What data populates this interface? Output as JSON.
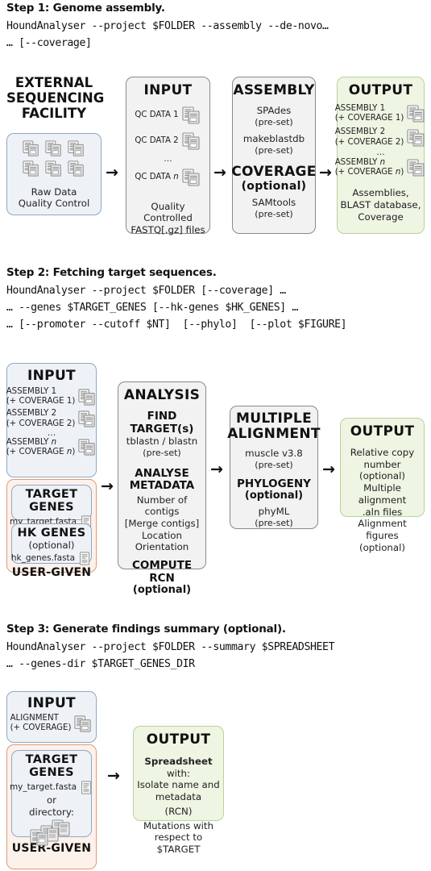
{
  "steps": [
    {
      "title": "Step 1: Genome assembly.",
      "commands": [
        "HoundAnalyser --project $FOLDER --assembly --de-novo…",
        "… [--coverage]"
      ]
    },
    {
      "title": "Step 2: Fetching target sequences.",
      "commands": [
        "HoundAnalyser --project $FOLDER [--coverage] …",
        "… --genes $TARGET_GENES [--hk-genes $HK_GENES] …",
        "… [--promoter --cutoff $NT]  [--phylo]  [--plot $FIGURE]"
      ]
    },
    {
      "title": "Step 3: Generate findings summary (optional).",
      "commands": [
        "HoundAnalyser --project $FOLDER --summary $SPREADSHEET",
        "… --genes-dir $TARGET_GENES_DIR"
      ]
    }
  ],
  "step1": {
    "facility_title": "EXTERNAL\nSEQUENCING\nFACILITY",
    "facility_line1": "Raw Data",
    "facility_line2": "Quality Control",
    "input": {
      "title": "INPUT",
      "items": [
        "QC DATA 1",
        "QC DATA 2",
        "QC DATA n"
      ],
      "ellipsis": "...",
      "footer_line1": "Quality Controlled",
      "footer_line2": "FASTQ[.gz] files"
    },
    "assembly": {
      "title": "ASSEMBLY",
      "tool1": "SPAdes",
      "tool1_note": "(pre-set)",
      "tool2": "makeblastdb",
      "tool2_note": "(pre-set)",
      "coverage_title": "COVERAGE",
      "coverage_optional": "(optional)",
      "tool3": "SAMtools",
      "tool3_note": "(pre-set)"
    },
    "output": {
      "title": "OUTPUT",
      "items": [
        [
          "ASSEMBLY 1",
          "(+ COVERAGE 1)"
        ],
        [
          "ASSEMBLY 2",
          "(+ COVERAGE 2)"
        ],
        [
          "ASSEMBLY n",
          "(+ COVERAGE n)"
        ]
      ],
      "ellipsis": "...",
      "footer": [
        "Assemblies,",
        "BLAST database,",
        "Coverage"
      ]
    }
  },
  "step2": {
    "input": {
      "title": "INPUT",
      "items": [
        [
          "ASSEMBLY 1",
          "(+ COVERAGE 1)"
        ],
        [
          "ASSEMBLY 2",
          "(+ COVERAGE 2)"
        ],
        [
          "ASSEMBLY n",
          "(+ COVERAGE n)"
        ]
      ],
      "ellipsis": "..."
    },
    "target_genes": {
      "title": "TARGET GENES",
      "file": "my_target.fasta"
    },
    "hk_genes": {
      "title": "HK GENES",
      "optional": "(optional)",
      "file": "hk_genes.fasta"
    },
    "user_given": "USER-GIVEN",
    "analysis": {
      "title": "ANALYSIS",
      "find_title": "FIND TARGET(s)",
      "find_tool": "tblastn / blastn",
      "find_note": "(pre-set)",
      "meta_title": "ANALYSE\nMETADATA",
      "meta_lines": [
        "Number of contigs",
        "[Merge contigs]",
        "Location",
        "Orientation"
      ],
      "rcn_title": "COMPUTE RCN",
      "rcn_note": "(optional)"
    },
    "alignment": {
      "title": "MULTIPLE\nALIGNMENT",
      "tool": "muscle v3.8",
      "tool_note": "(pre-set)",
      "phylo_title": "PHYLOGENY",
      "phylo_optional": "(optional)",
      "phylo_tool": "phyML",
      "phylo_note": "(pre-set)"
    },
    "output": {
      "title": "OUTPUT",
      "lines": [
        "Relative copy number",
        "(optional)",
        "Multiple alignment",
        ".aln files",
        "Alignment figures",
        "(optional)"
      ]
    }
  },
  "step3": {
    "input": {
      "title": "INPUT",
      "line1": "ALIGNMENT",
      "line2": "(+ COVERAGE)"
    },
    "target_genes": {
      "title": "TARGET GENES",
      "file": "my_target.fasta",
      "or": "or",
      "directory": "directory:"
    },
    "user_given": "USER-GIVEN",
    "output": {
      "title": "OUTPUT",
      "spreadsheet_bold": "Spreadsheet",
      "spreadsheet_rest": " with:",
      "lines": [
        "Isolate name and",
        "metadata",
        "(RCN)",
        "Mutations with",
        "respect to $TARGET"
      ]
    }
  },
  "icons": {
    "documents": "stacked-documents-icon",
    "document": "document-icon",
    "arrow": "→"
  },
  "colors": {
    "gray_fill": "#f2f2f2",
    "gray_border": "#8a8a8a",
    "blue_fill": "#eef2f7",
    "blue_border": "#8fa8c4",
    "green_fill": "#eef5e3",
    "green_border": "#bcd19a",
    "orange_fill": "#fdf1eb",
    "orange_border": "#e09b74",
    "text": "#1a1a1a"
  }
}
